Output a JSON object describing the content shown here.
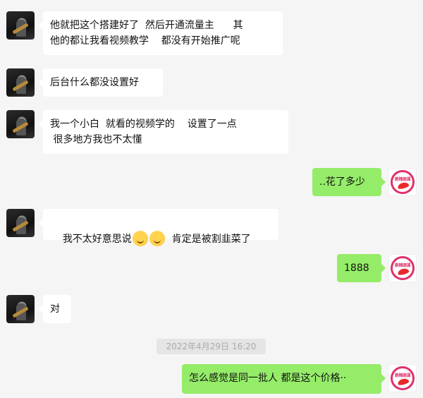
{
  "messages": [
    {
      "side": "left",
      "avatar": "contact-avatar",
      "text": "他就把这个搭建好了  然后开通流量主      其\n他的都让我看视频教学    都没有开始推广呢"
    },
    {
      "side": "left",
      "avatar": "contact-avatar",
      "text": "后台什么都没设置好"
    },
    {
      "side": "left",
      "avatar": "contact-avatar",
      "text": "我一个小白  就看的视频学的    设置了一点\n 很多地方我也不太懂"
    },
    {
      "side": "right",
      "avatar": "self-avatar",
      "text": "..花了多少"
    },
    {
      "side": "left",
      "avatar": "contact-avatar",
      "text_before": "我不太好意思说",
      "emoji": [
        "laugh-cry-emoji",
        "laugh-cry-emoji"
      ],
      "text_after": "  肯定是被割韭菜了"
    },
    {
      "side": "right",
      "avatar": "self-avatar",
      "text": "1888"
    },
    {
      "side": "left",
      "avatar": "contact-avatar",
      "text": "对"
    },
    {
      "side": "right",
      "avatar": "self-avatar",
      "text": "怎么感觉是同一批人 都是这个价格··"
    }
  ],
  "timestamp": "2022年4月29日 16:20",
  "self_avatar_text": "新辣商课",
  "colors": {
    "background": "#f5f5f5",
    "incoming_bubble": "#ffffff",
    "outgoing_bubble": "#95ec69",
    "brand_pink": "#e0306a"
  }
}
